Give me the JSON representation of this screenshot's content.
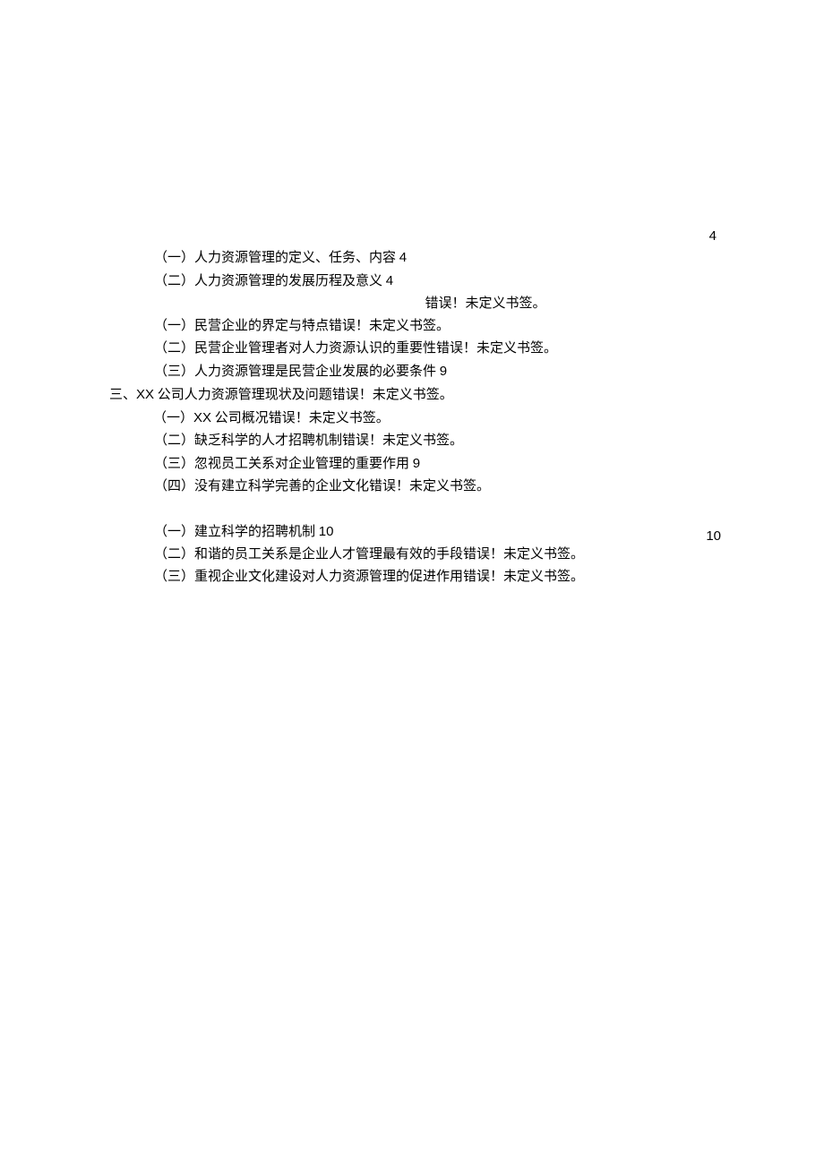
{
  "pageNumbers": {
    "top": "4",
    "mid": "10"
  },
  "lines": [
    {
      "type": "indent-1",
      "text": "（一）人力资源管理的定义、任务、内容",
      "page": "4"
    },
    {
      "type": "indent-1",
      "text": "（二）人力资源管理的发展历程及意义",
      "page": "4"
    },
    {
      "type": "centered-error",
      "text": "错误！未定义书签。"
    },
    {
      "type": "indent-1",
      "text": "（一）民营企业的界定与特点错误！未定义书签。"
    },
    {
      "type": "indent-1",
      "text": "（二）民营企业管理者对人力资源认识的重要性错误！未定义书签。"
    },
    {
      "type": "indent-1",
      "text": "（三）人力资源管理是民营企业发展的必要条件",
      "page": "9"
    },
    {
      "type": "indent-0",
      "prefix": "三、",
      "prefixBold": "XX",
      "text": " 公司人力资源管理现状及问题错误！未定义书签。"
    },
    {
      "type": "indent-2",
      "prefix": "（一）",
      "prefixBold": "XX",
      "text": " 公司概况错误！未定义书签。"
    },
    {
      "type": "indent-1",
      "text": "（二）缺乏科学的人才招聘机制错误！未定义书签。"
    },
    {
      "type": "indent-1",
      "text": "（三）忽视员工关系对企业管理的重要作用",
      "page": "9"
    },
    {
      "type": "indent-1",
      "text": "（四）没有建立科学完善的企业文化错误！未定义书签。"
    },
    {
      "type": "spacer"
    },
    {
      "type": "indent-1",
      "text": "（一）建立科学的招聘机制",
      "page": "10"
    },
    {
      "type": "indent-1",
      "text": "（二）和谐的员工关系是企业人才管理最有效的手段错误！未定义书签。"
    },
    {
      "type": "indent-1",
      "text": "（三）重视企业文化建设对人力资源管理的促进作用错误！未定义书签。"
    }
  ]
}
